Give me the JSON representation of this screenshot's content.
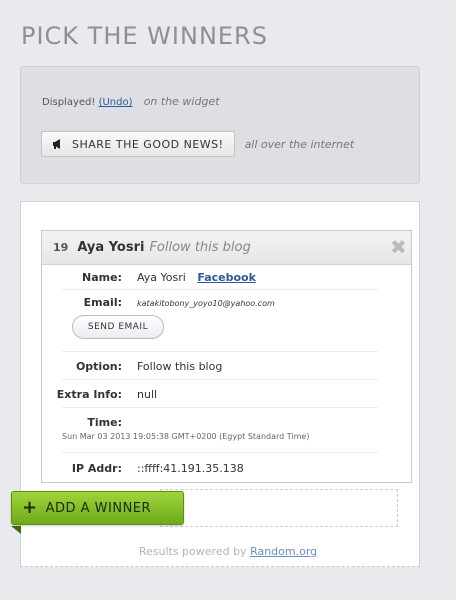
{
  "page": {
    "title": "PICK THE WINNERS"
  },
  "top_panel": {
    "displayed_text": "Displayed!",
    "undo_label": "(Undo)",
    "widget_text": "on the widget",
    "share_button_label": "SHARE THE GOOD NEWS!",
    "internet_text": "all over the internet"
  },
  "winner": {
    "number": "19",
    "name": "Aya Yosri",
    "option_header": "Follow this blog",
    "labels": {
      "name": "Name:",
      "email": "Email:",
      "option": "Option:",
      "extra": "Extra Info:",
      "time": "Time:",
      "ip": "IP Addr:"
    },
    "name_value": "Aya Yosri",
    "facebook_label": "Facebook",
    "email_value": "katakitobony_yoyo10@yahoo.com",
    "send_email_label": "SEND EMAIL",
    "option_value": "Follow this blog",
    "extra_value": "null",
    "time_value": "Sun Mar 03 2013 19:05:38 GMT+0200 (Egypt Standard Time)",
    "ip_value": "::ffff:41.191.35.138"
  },
  "add_winner_label": "ADD A WINNER",
  "footer": {
    "powered_text": "Results powered by",
    "random_link": "Random.org"
  },
  "colors": {
    "accent_green": "#8cc730",
    "link_blue": "#2a5a9c"
  }
}
